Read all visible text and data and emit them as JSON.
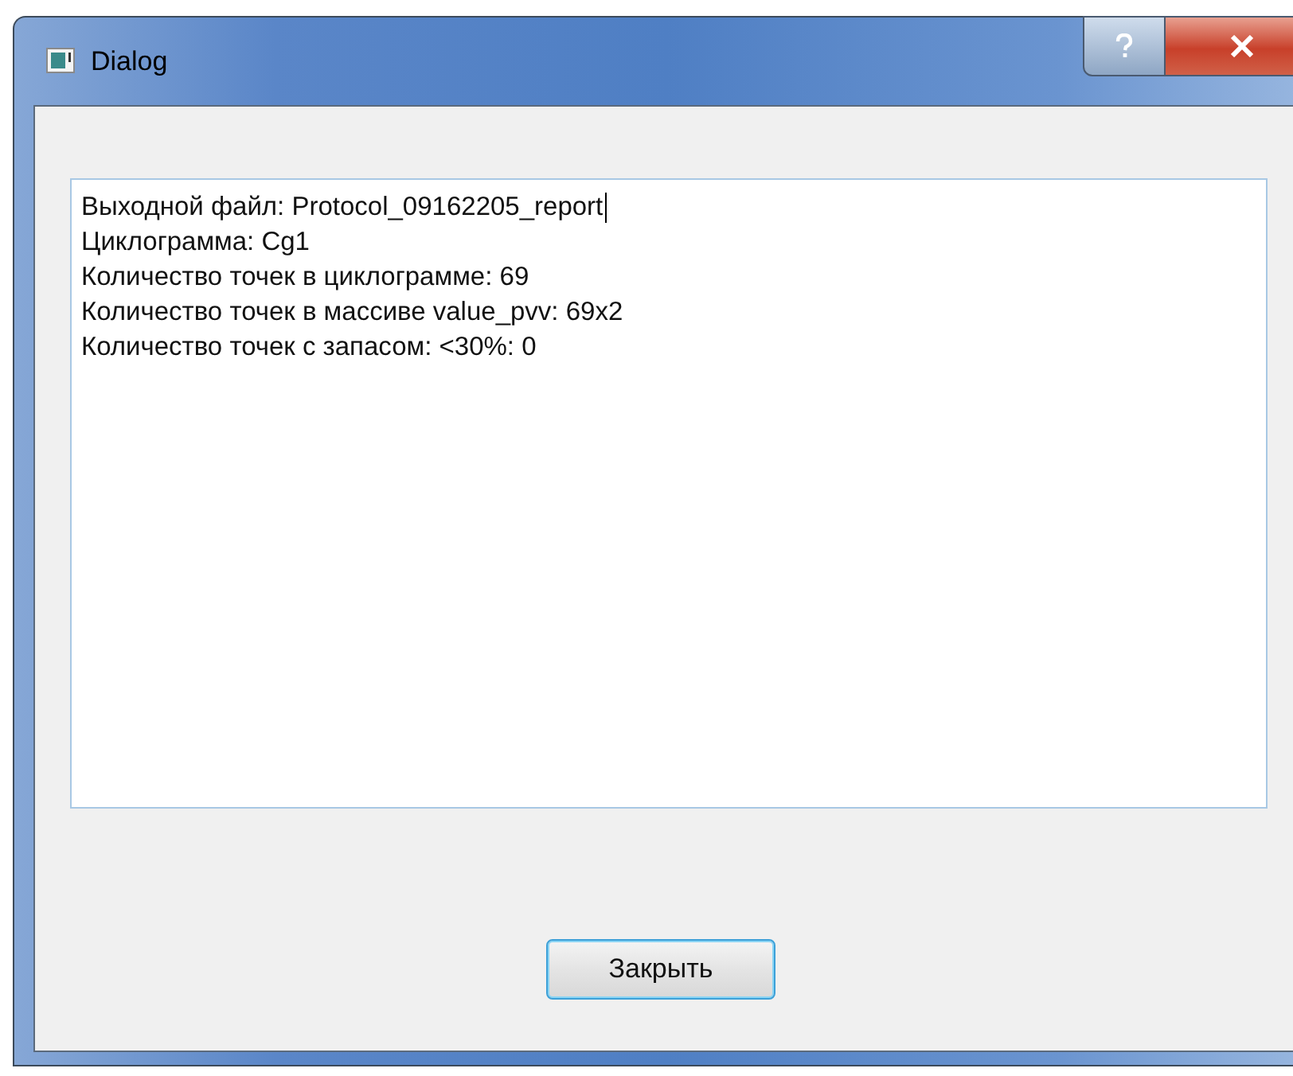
{
  "window": {
    "title": "Dialog"
  },
  "output": {
    "lines": [
      {
        "text": "Выходной файл: Protocol_09162205_report",
        "caret": true
      },
      {
        "text": "Циклограмма: Cg1",
        "caret": false
      },
      {
        "text": "Количество точек в циклограмме: 69",
        "caret": false
      },
      {
        "text": "Количество точек в массиве value_pvv: 69x2",
        "caret": false
      },
      {
        "text": "Количество точек с запасом: <30%: 0",
        "caret": false
      }
    ]
  },
  "buttons": [
    {
      "label": "Закрыть",
      "focused": true
    }
  ]
}
